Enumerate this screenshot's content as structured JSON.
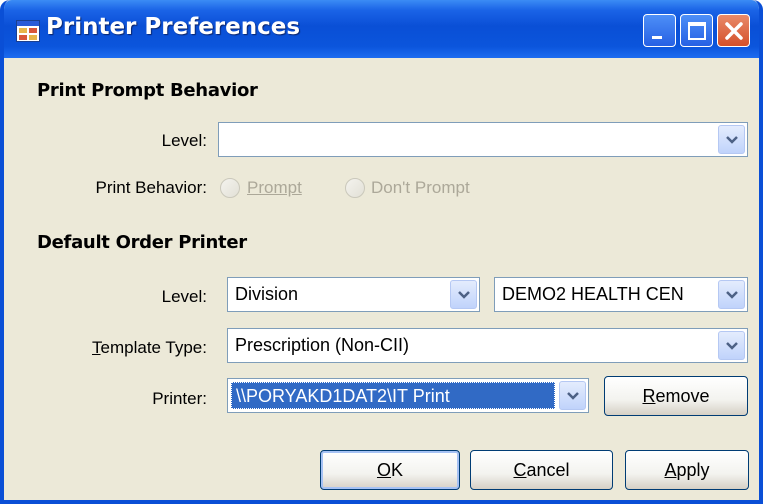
{
  "window": {
    "title": "Printer Preferences",
    "icon": "printer-preferences-icon"
  },
  "caption_buttons": [
    "minimize-icon",
    "maximize-icon",
    "close-icon"
  ],
  "print_prompt": {
    "section_title": "Print Prompt Behavior",
    "level_label": "Level:",
    "level_value": "",
    "behavior_label": "Print Behavior:",
    "option_prompt": "Prompt",
    "option_dont_prompt": "Don't Prompt"
  },
  "default_printer": {
    "section_title": "Default Order Printer",
    "level_label": "Level:",
    "level_value": "Division",
    "division_value": "DEMO2 HEALTH CEN",
    "template_label": "Template Type:",
    "template_value": "Prescription (Non-CII)",
    "printer_label": "Printer:",
    "printer_value": "\\\\PORYAKD1DAT2\\IT Print",
    "remove_label": "Remove"
  },
  "buttons": {
    "ok": "OK",
    "cancel": "Cancel",
    "apply": "Apply"
  },
  "colors": {
    "titlebar": "#0a4fd6",
    "dialog_bg": "#ece9d8",
    "selection": "#316ac5",
    "close_button": "#d4502a"
  }
}
